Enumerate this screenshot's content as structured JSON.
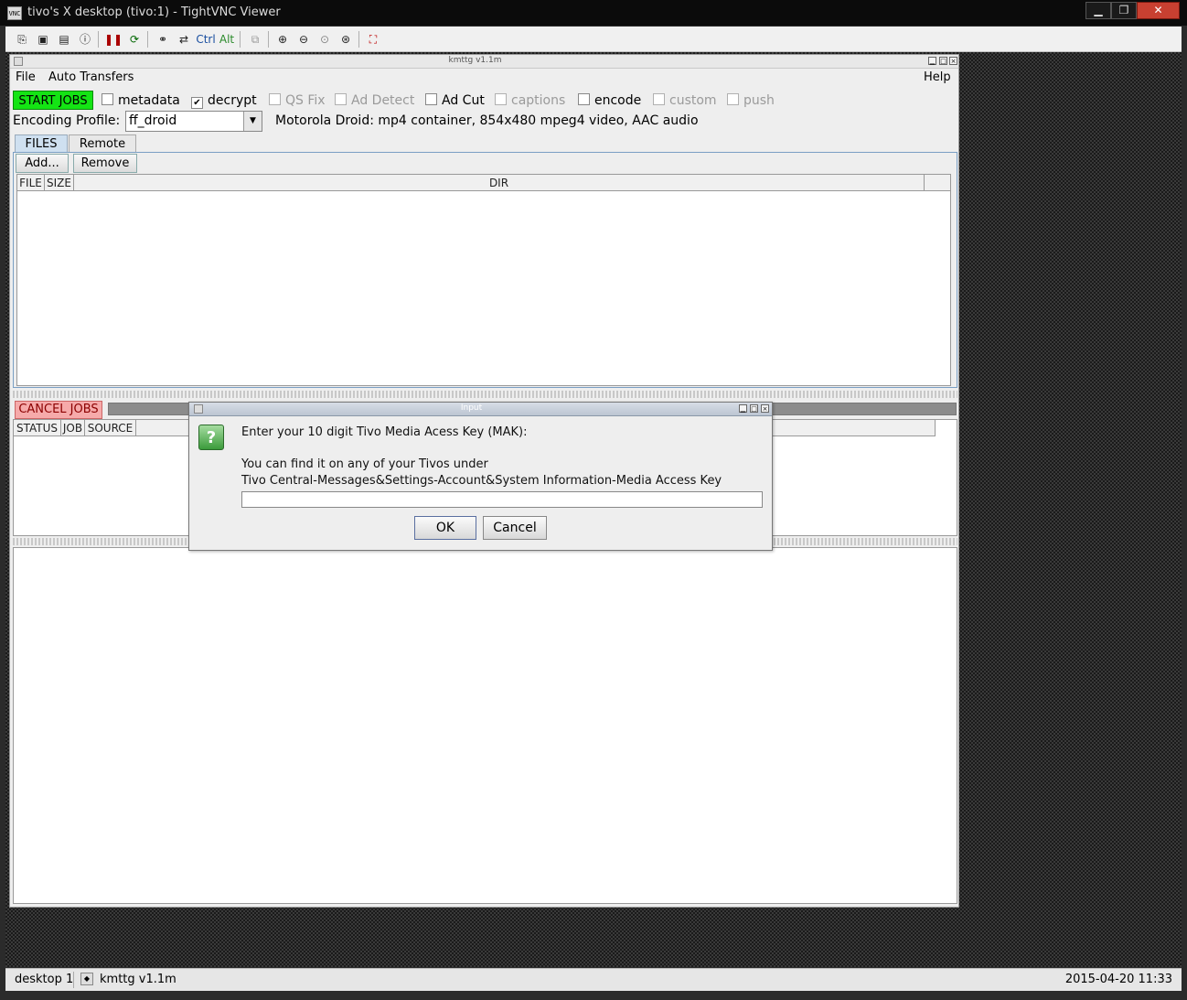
{
  "vnc": {
    "title": "tivo's X desktop (tivo:1) - TightVNC Viewer",
    "icon_text": "VNC",
    "window_controls": [
      "minimize-icon",
      "maximize-icon",
      "close-icon"
    ],
    "toolbar": {
      "ctrl_label": "Ctrl",
      "alt_label": "Alt",
      "icons": [
        "new-connection-icon",
        "save-icon",
        "options-icon",
        "info-icon",
        "pause-icon",
        "refresh-icon",
        "chat-icon",
        "transfer-icon",
        "ctrl-key-icon",
        "alt-key-icon",
        "clipboard-icon",
        "zoom-in-icon",
        "zoom-out-icon",
        "zoom-100-icon",
        "zoom-fit-icon",
        "fullscreen-icon"
      ]
    }
  },
  "app": {
    "title": "kmttg v1.1m",
    "menu": {
      "file": "File",
      "auto_transfers": "Auto Transfers",
      "help": "Help"
    },
    "start_jobs": "START JOBS",
    "options": [
      {
        "label": "metadata",
        "checked": false,
        "enabled": true
      },
      {
        "label": "decrypt",
        "checked": true,
        "enabled": true
      },
      {
        "label": "QS Fix",
        "checked": false,
        "enabled": false
      },
      {
        "label": "Ad Detect",
        "checked": false,
        "enabled": false
      },
      {
        "label": "Ad Cut",
        "checked": false,
        "enabled": true
      },
      {
        "label": "captions",
        "checked": false,
        "enabled": false
      },
      {
        "label": "encode",
        "checked": false,
        "enabled": true
      },
      {
        "label": "custom",
        "checked": false,
        "enabled": false
      },
      {
        "label": "push",
        "checked": false,
        "enabled": false
      }
    ],
    "encoding": {
      "label": "Encoding Profile:",
      "value": "ff_droid",
      "description": "Motorola Droid: mp4 container, 854x480 mpeg4 video, AAC audio"
    },
    "tabs": {
      "files": "FILES",
      "remote": "Remote"
    },
    "files_panel": {
      "add_button": "Add...",
      "remove_button": "Remove",
      "columns": [
        "FILE",
        "SIZE",
        "DIR"
      ]
    },
    "cancel_jobs": "CANCEL JOBS",
    "jobs_columns": [
      "STATUS",
      "JOB",
      "SOURCE"
    ]
  },
  "dialog": {
    "title": "Input",
    "line1": "Enter your 10 digit Tivo Media Acess Key (MAK):",
    "line2": "You can find it on any of your Tivos under",
    "line3": "Tivo Central-Messages&Settings-Account&System Information-Media Access Key",
    "input_value": "",
    "ok": "OK",
    "cancel": "Cancel"
  },
  "taskbar": {
    "desktop": "desktop 1",
    "app": "kmttg v1.1m",
    "clock": "2015-04-20 11:33"
  }
}
